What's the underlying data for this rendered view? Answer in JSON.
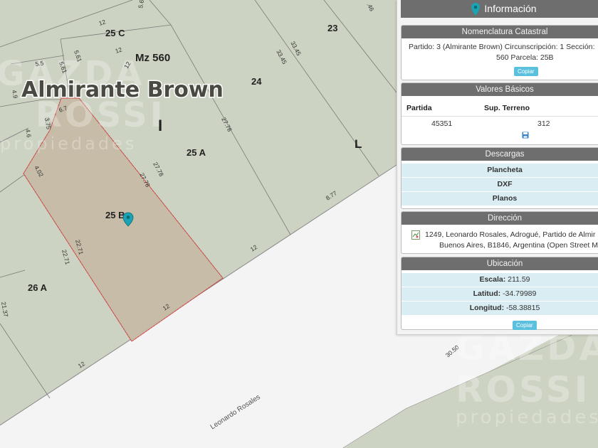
{
  "map": {
    "block_labels": [
      "25 C",
      "Mz 560",
      "24",
      "23",
      "25 A",
      "25 B",
      "26 A",
      "I",
      "L"
    ],
    "district_label": "Almirante Brown",
    "street_name": "Leonardo Rosales",
    "dimensions": [
      "12",
      "5.61",
      "5.5",
      "5.61",
      "5.61",
      "12",
      "12",
      "6.7",
      "4.9",
      "3.75",
      "4.6",
      "4.02",
      "27.78",
      "27.78",
      "27.78",
      "33.45",
      "33.45",
      "22.71",
      "22.71",
      "12",
      "8.77",
      "12",
      "12",
      "30.50",
      "21.37",
      ".46"
    ],
    "watermark": {
      "line1": "GAZDA",
      "line2": "ROSSI",
      "line3": "propiedades"
    },
    "colors": {
      "background": "#cdd3c2",
      "selected_lot": "#c7bba6",
      "selected_border": "#d9534f",
      "street": "#f4f4f4",
      "marker": "#1aa3b3"
    },
    "marker_icon": "map-pin-icon"
  },
  "panel": {
    "title": "Información",
    "nomenclatura": {
      "header": "Nomenclatura Catastral",
      "line1": "Partido: 3 (Almirante Brown) Circunscripción: 1 Sección:",
      "line2": "560 Parcela: 25B",
      "copy_label": "Copiar"
    },
    "valores": {
      "header": "Valores Básicos",
      "col_partida": "Partida",
      "col_sup": "Sup. Terreno",
      "partida": "45351",
      "sup": "312",
      "save_icon": "save-icon"
    },
    "descargas": {
      "header": "Descargas",
      "items": [
        "Plancheta",
        "DXF",
        "Planos"
      ]
    },
    "direccion": {
      "header": "Dirección",
      "line1": "1249, Leonardo Rosales, Adrogué, Partido de Almir",
      "line2": "Buenos Aires, B1846, Argentina (Open Street M",
      "icon": "map-document-icon"
    },
    "ubicacion": {
      "header": "Ubicación",
      "escala_label": "Escala:",
      "escala": "211.59",
      "latitud_label": "Latitud:",
      "latitud": "-34.79989",
      "longitud_label": "Longitud:",
      "longitud": "-58.38815",
      "copy_label": "Copiar"
    }
  }
}
